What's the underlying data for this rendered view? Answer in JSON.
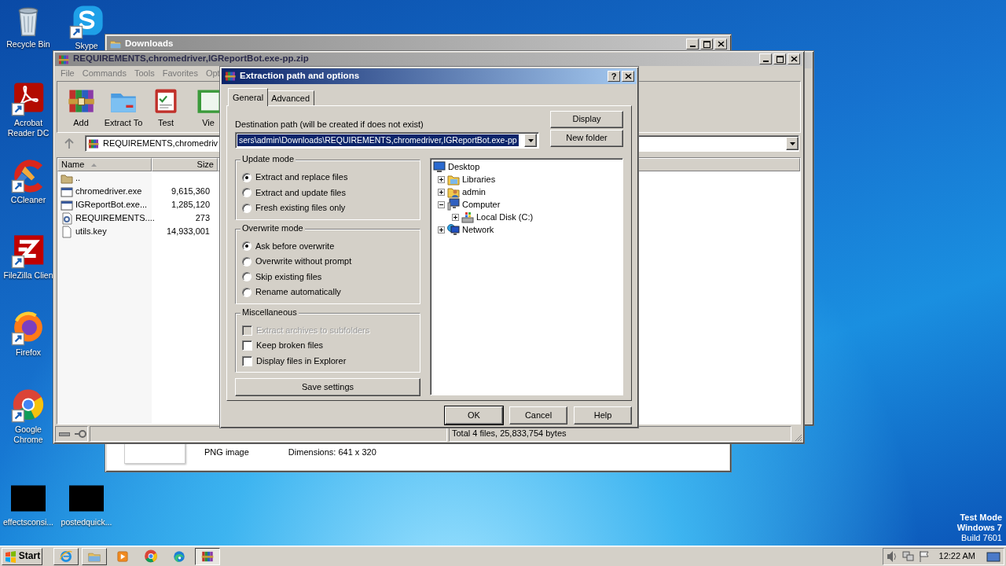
{
  "desktop_icons": [
    {
      "label": "Recycle Bin",
      "kind": "recycle",
      "shortcut": false
    },
    {
      "label": "Skype",
      "kind": "skype",
      "shortcut": true
    },
    {
      "label": "Acrobat Reader DC",
      "kind": "acrobat",
      "shortcut": true
    },
    {
      "label": "CCleaner",
      "kind": "ccleaner",
      "shortcut": true
    },
    {
      "label": "FileZilla Clien",
      "kind": "filezilla",
      "shortcut": true
    },
    {
      "label": "Firefox",
      "kind": "firefox",
      "shortcut": true
    },
    {
      "label": "Google Chrome",
      "kind": "chrome",
      "shortcut": true
    },
    {
      "label": "effectsconsi...",
      "kind": "thumb",
      "shortcut": false
    },
    {
      "label": "postedquick...",
      "kind": "thumb",
      "shortcut": false
    }
  ],
  "downloads_window": {
    "title": "Downloads",
    "file_type": "PNG image",
    "dimensions": "Dimensions: 641 x 320"
  },
  "archive_window": {
    "title": "REQUIREMENTS,chromedriver,IGReportBot.exe-pp.zip",
    "menu": [
      "File",
      "Commands",
      "Tools",
      "Favorites",
      "Opt"
    ],
    "toolbar": [
      {
        "label": "Add",
        "kind": "add"
      },
      {
        "label": "Extract To",
        "kind": "extract"
      },
      {
        "label": "Test",
        "kind": "test"
      },
      {
        "label": "Vie",
        "kind": "view"
      }
    ],
    "address": "REQUIREMENTS,chromedriv",
    "columns": [
      "Name",
      "Size"
    ],
    "rows": [
      {
        "name": "..",
        "kind": "folder"
      },
      {
        "name": "chromedriver.exe",
        "size": "9,615,360",
        "kind": "exe"
      },
      {
        "name": "IGReportBot.exe...",
        "size": "1,285,120",
        "kind": "exe"
      },
      {
        "name": "REQUIREMENTS....",
        "size": "273",
        "kind": "config"
      },
      {
        "name": "utils.key",
        "size": "14,933,001",
        "kind": "file"
      }
    ],
    "status": "Total 4 files, 25,833,754 bytes"
  },
  "dialog": {
    "title": "Extraction path and options",
    "help_glyph": "?",
    "tabs": [
      {
        "label": "General",
        "selected": true
      },
      {
        "label": "Advanced",
        "selected": false
      }
    ],
    "path_label": "Destination path (will be created if does not exist)",
    "path_value": "sers\\admin\\Downloads\\REQUIREMENTS,chromedriver,IGReportBot.exe-pp",
    "side_buttons": [
      "Display",
      "New folder"
    ],
    "groups": [
      {
        "title": "Update mode",
        "kind": "radio",
        "options": [
          {
            "label": "Extract and replace files",
            "selected": true
          },
          {
            "label": "Extract and update files",
            "selected": false
          },
          {
            "label": "Fresh existing files only",
            "selected": false
          }
        ]
      },
      {
        "title": "Overwrite mode",
        "kind": "radio",
        "options": [
          {
            "label": "Ask before overwrite",
            "selected": true
          },
          {
            "label": "Overwrite without prompt",
            "selected": false
          },
          {
            "label": "Skip existing files",
            "selected": false
          },
          {
            "label": "Rename automatically",
            "selected": false
          }
        ]
      },
      {
        "title": "Miscellaneous",
        "kind": "checkbox",
        "options": [
          {
            "label": "Extract archives to subfolders",
            "checked": false,
            "disabled": true
          },
          {
            "label": "Keep broken files",
            "checked": false,
            "disabled": false
          },
          {
            "label": "Display files in Explorer",
            "checked": false,
            "disabled": false
          }
        ]
      }
    ],
    "save_button": "Save settings",
    "tree": [
      {
        "label": "Desktop",
        "kind": "desktop",
        "children": [
          {
            "label": "Libraries",
            "kind": "libraries",
            "expanded": false
          },
          {
            "label": "admin",
            "kind": "user",
            "expanded": false
          },
          {
            "label": "Computer",
            "kind": "computer",
            "expanded": true,
            "children": [
              {
                "label": "Local Disk (C:)",
                "kind": "disk",
                "expanded": false
              }
            ]
          },
          {
            "label": "Network",
            "kind": "network",
            "expanded": false
          }
        ]
      }
    ],
    "buttons": [
      "OK",
      "Cancel",
      "Help"
    ]
  },
  "os_notice": [
    "Test Mode",
    "Windows 7",
    "Build 7601"
  ],
  "taskbar": {
    "start": "Start",
    "apps": [
      {
        "kind": "ie",
        "selected": false
      },
      {
        "kind": "explorer",
        "selected": false
      },
      {
        "kind": "media",
        "selected": false
      },
      {
        "kind": "chrome",
        "selected": false
      },
      {
        "kind": "edge",
        "selected": false
      },
      {
        "kind": "winrar",
        "selected": true
      }
    ],
    "clock": "12:22 AM"
  }
}
